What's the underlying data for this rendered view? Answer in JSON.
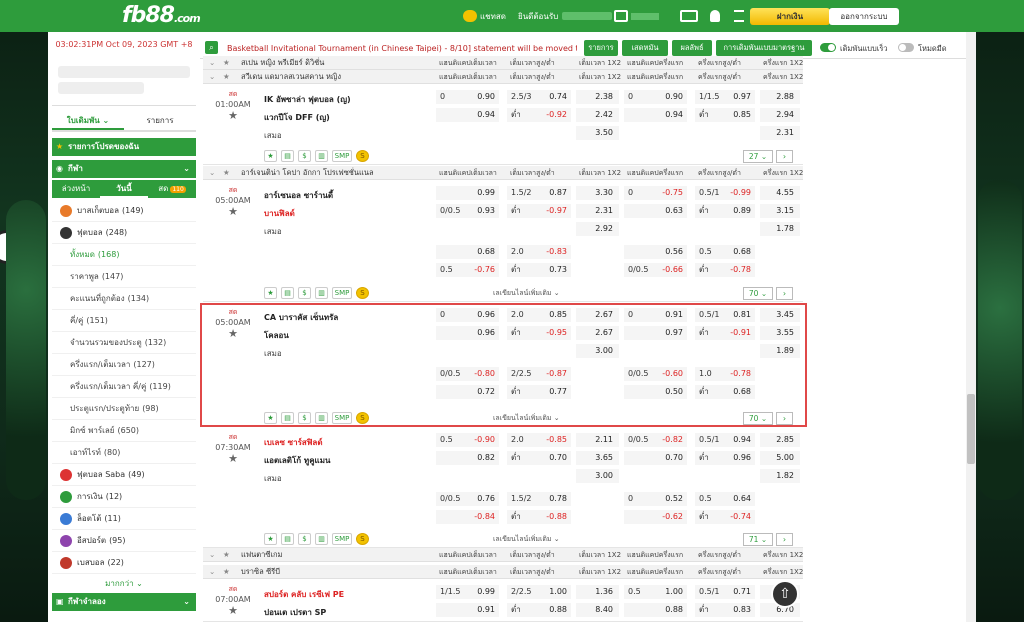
{
  "header": {
    "logo": "fb88",
    "logo_suffix": ".com",
    "nav": [
      "แชทสด",
      "ยินดีต้อนรับ"
    ],
    "deposit": "ฝากเงิน",
    "logout": "ออกจากระบบ"
  },
  "sidebar": {
    "clock": "03:02:31PM Oct 09, 2023 GMT +8",
    "tabs": [
      "ใบเดิมพัน",
      "รายการ"
    ],
    "my_bets": "รายการโปรดของฉัน",
    "sports": "กีฬา",
    "subtabs": [
      "ล่วงหน้า",
      "วันนี้",
      "สด"
    ],
    "live_count": "110",
    "items": [
      {
        "label": "บาสเก็ตบอล",
        "count": "(149)",
        "color": "#e87a2a"
      },
      {
        "label": "ฟุตบอล",
        "count": "(248)",
        "color": "#333"
      }
    ],
    "sub_items": [
      {
        "label": "ทั้งหมด",
        "count": "(168)",
        "active": true
      },
      {
        "label": "ราคาพูล",
        "count": "(147)"
      },
      {
        "label": "คะแนนที่ถูกต้อง",
        "count": "(134)"
      },
      {
        "label": "คี่/คู่",
        "count": "(151)"
      },
      {
        "label": "จำนวนรวมของประตู",
        "count": "(132)"
      },
      {
        "label": "ครึ่งแรก/เต็มเวลา",
        "count": "(127)"
      },
      {
        "label": "ครึ่งแรก/เต็มเวลา คี่/คู่",
        "count": "(119)"
      },
      {
        "label": "ประตูแรก/ประตูท้าย",
        "count": "(98)"
      },
      {
        "label": "มิกซ์ พาร์เลย์",
        "count": "(650)"
      },
      {
        "label": "เอาท์ไรท์",
        "count": "(80)"
      }
    ],
    "items2": [
      {
        "label": "ฟุตบอล Saba",
        "count": "(49)",
        "color": "#d33"
      },
      {
        "label": "การเงิน",
        "count": "(12)",
        "color": "#2e9c3c"
      },
      {
        "label": "ล็อตโต้",
        "count": "(11)",
        "color": "#3a7bd5"
      },
      {
        "label": "อีสปอร์ต",
        "count": "(95)",
        "color": "#8e44ad"
      },
      {
        "label": "เบสบอล",
        "count": "(22)",
        "color": "#c0392b"
      }
    ],
    "more": "มากกว่า",
    "virtual": "กีฬาจำลอง"
  },
  "topbar": {
    "ticker": "Basketball Invitational Tournament (in Chinese Taipei) - 8/10] statement will be moved to",
    "buttons": [
      "รายการ",
      "เสดหมัน",
      "ผลลัพธ์",
      "การเดิมพันแบบมาตรฐานเอเชีย"
    ],
    "quick_bet": "เดิมพันแบบเร็ว",
    "dark_mode": "โหมดมืด"
  },
  "columns": [
    "แฮนดิแคปเต็มเวลา",
    "เต็มเวลาสูง/ต่ำ",
    "เต็มเวลา 1X2",
    "แฮนดิแคปครึ่งแรก",
    "ครึ่งแรกสูง/ต่ำ",
    "ครึ่งแรก 1X2"
  ],
  "leagues": [
    "สเปน หญิง พรีเมียร์ ดิวิชั่น",
    "สวีเดน แดมาลสเวนสคาน หญิง",
    "อาร์เจนติน่า โคปา อักกา โปรเฟซชั่นแนล",
    "แฟนตาซีเกม",
    "บราซิล ซีรีบี"
  ],
  "matches": [
    {
      "time": "01:00AM",
      "live": "สด",
      "home": "IK อัพซาล่า ฟุตบอล (ญ)",
      "away": "แวกปีโจ DFF (ญ)",
      "draw": "เสมอ",
      "r1": {
        "fh": "0",
        "fo": "0.90",
        "oh": "2.5/3",
        "oo": "0.74",
        "x1": "2.38",
        "hh": "0",
        "ho": "0.90",
        "hoh": "1/1.5",
        "hoo": "0.97",
        "hx": "2.88"
      },
      "r2": {
        "fo": "0.94",
        "oh": "ต่ำ",
        "oo": "-0.92",
        "x1": "2.42",
        "ho": "0.94",
        "hoh": "ต่ำ",
        "hoo": "0.85",
        "hx": "2.94"
      },
      "r3": {
        "x1": "3.50",
        "hx": "2.31"
      },
      "page": "27"
    },
    {
      "time": "05:00AM",
      "live": "สด",
      "home": "อาร์เซนอล ซาร์านดี้",
      "away": "บานฟิลด์",
      "draw": "เสมอ",
      "r1": {
        "fh": "",
        "fo": "0.99",
        "oh": "1.5/2",
        "oo": "0.87",
        "x1": "3.30",
        "hh": "0",
        "ho": "-0.75",
        "hoh": "0.5/1",
        "hoo": "-0.99",
        "hx": "4.55"
      },
      "r2": {
        "fh": "0/0.5",
        "fo": "0.93",
        "oh": "ต่ำ",
        "oo": "-0.97",
        "x1": "2.31",
        "ho": "0.63",
        "hoh": "ต่ำ",
        "hoo": "0.89",
        "hx": "3.15"
      },
      "r3": {
        "x1": "2.92",
        "hx": "1.78"
      },
      "e1": {
        "fo": "0.68",
        "oh": "2.0",
        "oo": "-0.83",
        "ho": "0.56",
        "hoh": "0.5",
        "hoo": "0.68"
      },
      "e2": {
        "fh": "0.5",
        "fo": "-0.76",
        "oh": "ต่ำ",
        "oo": "0.73",
        "hh": "0/0.5",
        "ho": "-0.66",
        "hoh": "ต่ำ",
        "hoo": "-0.78"
      },
      "page": "70",
      "more": "เลเขียนไลน์เพิ่มเติม"
    },
    {
      "time": "05:00AM",
      "live": "สด",
      "home": "CA บาราคัส เซ็นทรัล",
      "away": "โคลอน",
      "draw": "เสมอ",
      "r1": {
        "fh": "0",
        "fo": "0.96",
        "oh": "2.0",
        "oo": "0.85",
        "x1": "2.67",
        "hh": "0",
        "ho": "0.91",
        "hoh": "0.5/1",
        "hoo": "0.81",
        "hx": "3.45"
      },
      "r2": {
        "fo": "0.96",
        "oh": "ต่ำ",
        "oo": "-0.95",
        "x1": "2.67",
        "ho": "0.97",
        "hoh": "ต่ำ",
        "hoo": "-0.91",
        "hx": "3.55"
      },
      "r3": {
        "x1": "3.00",
        "hx": "1.89"
      },
      "e1": {
        "fh": "0/0.5",
        "fo": "-0.80",
        "oh": "2/2.5",
        "oo": "-0.87",
        "hh": "0/0.5",
        "ho": "-0.60",
        "hoh": "1.0",
        "hoo": "-0.78"
      },
      "e2": {
        "fo": "0.72",
        "oh": "ต่ำ",
        "oo": "0.77",
        "ho": "0.50",
        "hoh": "ต่ำ",
        "hoo": "0.68"
      },
      "page": "70",
      "more": "เลเขียนไลน์เพิ่มเติม"
    },
    {
      "time": "07:30AM",
      "live": "สด",
      "home": "เบเลซ ซาร์สฟิลด์",
      "away": "แอตเลติโก้ ทูคูแมน",
      "draw": "เสมอ",
      "r1": {
        "fh": "0.5",
        "fo": "-0.90",
        "oh": "2.0",
        "oo": "-0.85",
        "x1": "2.11",
        "hh": "0/0.5",
        "ho": "-0.82",
        "hoh": "0.5/1",
        "hoo": "0.94",
        "hx": "2.85"
      },
      "r2": {
        "fo": "0.82",
        "oh": "ต่ำ",
        "oo": "0.70",
        "x1": "3.65",
        "ho": "0.70",
        "hoh": "ต่ำ",
        "hoo": "0.96",
        "hx": "5.00"
      },
      "r3": {
        "x1": "3.00",
        "hx": "1.82"
      },
      "e1": {
        "fh": "0/0.5",
        "fo": "0.76",
        "oh": "1.5/2",
        "oo": "0.78",
        "hh": "0",
        "ho": "0.52",
        "hoh": "0.5",
        "hoo": "0.64"
      },
      "e2": {
        "fo": "-0.84",
        "oh": "ต่ำ",
        "oo": "-0.88",
        "ho": "-0.62",
        "hoh": "ต่ำ",
        "hoo": "-0.74"
      },
      "page": "71",
      "more": "เลเขียนไลน์เพิ่มเติม"
    },
    {
      "time": "07:00AM",
      "live": "สด",
      "home": "สปอร์ต คลับ เรซีเฟ PE",
      "away": "ปอนเต เปรตา SP",
      "r1": {
        "fh": "1/1.5",
        "fo": "0.99",
        "oh": "2/2.5",
        "oo": "1.00",
        "x1": "1.36",
        "hh": "0.5",
        "ho": "1.00",
        "hoh": "0.5/1",
        "hoo": "0.71",
        "hx": "2.01"
      },
      "r2": {
        "fo": "0.91",
        "oh": "ต่ำ",
        "oo": "0.88",
        "x1": "8.40",
        "ho": "0.88",
        "hoh": "ต่ำ",
        "hoo": "0.83",
        "hx": "6.70"
      }
    }
  ]
}
